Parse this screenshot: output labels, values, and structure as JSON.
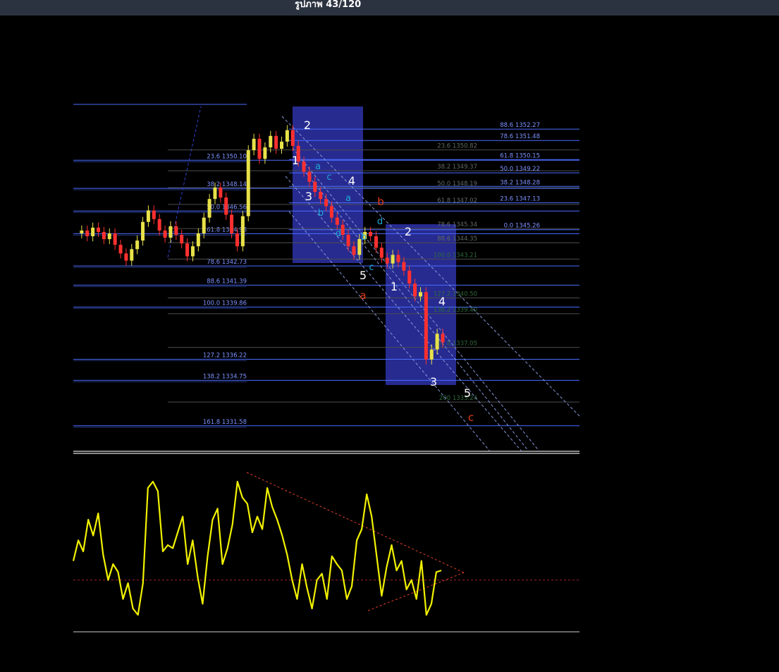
{
  "window": {
    "title": "รูปภาพ 43/120"
  },
  "chart_data": {
    "type": "line",
    "price_panel": {
      "fib_left": [
        "23.6 1350.10",
        "38.2 1348.14",
        "50.0 1346.56",
        "61.8 1344.98",
        "78.6 1342.73",
        "88.6 1341.39",
        "100.0 1339.86",
        "127.2 1336.22",
        "138.2 1334.75",
        "161.8 1331.58"
      ],
      "fib_middle": [
        "23.6 1350.82",
        "38.2 1349.37",
        "50.0 1348.19",
        "61.8 1347.02",
        "78.6 1345.34",
        "88.6 1344.35",
        "100.0 1343.21",
        "127.2 1340.50",
        "138.2 1339.40",
        "161.8 1337.05",
        "200 1333.24"
      ],
      "fib_right": [
        "88.6 1352.27",
        "78.6 1351.48",
        "61.8 1350.15",
        "50.0 1349.22",
        "38.2 1348.28",
        "23.6 1347.13",
        "0.0 1345.26"
      ],
      "wave_labels": [
        "1",
        "2",
        "3",
        "4",
        "5",
        "1",
        "2",
        "3",
        "4",
        "5"
      ],
      "subwave_labels": [
        "a",
        "b",
        "c",
        "d",
        "a",
        "b",
        "c",
        "d",
        "a",
        "b",
        "c"
      ],
      "correction_labels": [
        "a",
        "b",
        "c"
      ],
      "price_path": [
        1345.0,
        1345.2,
        1344.8,
        1345.4,
        1345.1,
        1344.6,
        1345.0,
        1344.2,
        1343.6,
        1343.1,
        1343.9,
        1344.5,
        1345.8,
        1346.6,
        1346.0,
        1345.2,
        1344.7,
        1345.5,
        1344.9,
        1344.3,
        1343.4,
        1344.1,
        1345.0,
        1346.1,
        1347.4,
        1348.2,
        1347.5,
        1346.3,
        1345.0,
        1344.1,
        1346.2,
        1350.8,
        1351.6,
        1350.2,
        1351.0,
        1351.8,
        1350.9,
        1351.4,
        1352.2,
        1351.1,
        1350.0,
        1349.3,
        1348.6,
        1347.9,
        1347.4,
        1346.9,
        1346.1,
        1345.6,
        1344.9,
        1344.1,
        1343.5,
        1344.6,
        1345.1,
        1344.8,
        1344.0,
        1343.3,
        1342.9,
        1343.5,
        1343.0,
        1342.4,
        1341.5,
        1340.6,
        1340.9,
        1336.2,
        1336.9,
        1338.0,
        1337.4
      ],
      "ylim": [
        1329.8,
        1354.0
      ]
    },
    "oscillator_panel": {
      "values": [
        42,
        55,
        48,
        68,
        58,
        72,
        46,
        30,
        40,
        35,
        18,
        28,
        12,
        8,
        28,
        88,
        92,
        86,
        48,
        52,
        50,
        60,
        70,
        40,
        55,
        32,
        15,
        45,
        68,
        75,
        40,
        50,
        65,
        92,
        82,
        78,
        60,
        70,
        62,
        88,
        76,
        68,
        58,
        46,
        30,
        18,
        40,
        25,
        12,
        30,
        34,
        18,
        45,
        40,
        36,
        18,
        26,
        55,
        62,
        84,
        70,
        45,
        20,
        38,
        52,
        36,
        42,
        24,
        30,
        18,
        42,
        8,
        15,
        35,
        36
      ],
      "ylim": [
        0,
        100
      ],
      "zero_line": 30,
      "x_tick_labels": [
        "",
        "",
        "",
        "",
        "",
        "",
        "",
        "",
        "",
        ""
      ]
    }
  },
  "colors": {
    "background": "#000000",
    "fib_line": "#4a6cff",
    "fib_label": "#7e92ff",
    "fib_label_alt": "#2f6a3b",
    "zone": "#2a2f9c",
    "bull_candle": "#e8e24a",
    "bear_candle": "#ff3030",
    "oscillator": "#f2f200",
    "wave_white": "#ffffff",
    "wave_cyan": "#1ea7d6",
    "wave_red": "#e33b1a",
    "trend_dashed": "#e04028"
  },
  "icons": []
}
